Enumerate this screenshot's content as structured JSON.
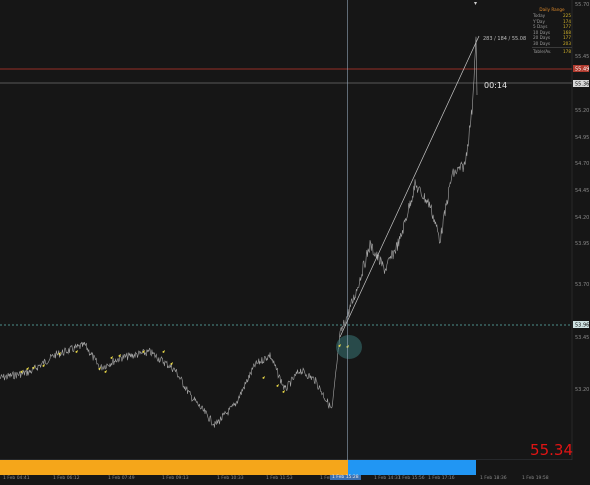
{
  "price_axis": {
    "ticks": [
      "55.70",
      "55.45",
      "55.20",
      "54.95",
      "54.70",
      "54.45",
      "54.20",
      "53.95",
      "53.70",
      "53.45",
      "53.20"
    ],
    "current_price_label": "55.36",
    "red_line_label": "55.49",
    "crosshair_price_label": "53.96"
  },
  "big_price": "55.34",
  "timer": "00:14",
  "hover_text": "283 / 184 / 55.08",
  "range_panel": {
    "title": "Daily Range",
    "rows": [
      {
        "label": "Today",
        "value": "225"
      },
      {
        "label": "Y'Day",
        "value": "174"
      },
      {
        "label": "5 Days",
        "value": "177"
      },
      {
        "label": "10 Days",
        "value": "168"
      },
      {
        "label": "20 Days",
        "value": "177"
      },
      {
        "label": "30 Days",
        "value": "203"
      }
    ],
    "footer_label": "Table/Av.",
    "footer_value": "178"
  },
  "time_axis": {
    "labels": [
      "1 Feb 04:41",
      "1 Feb 06:12",
      "1 Feb 07:49",
      "1 Feb 09:13",
      "1 Feb 10:33",
      "1 Feb 11:53",
      "1 Feb 13:14",
      "1 Feb 14:37",
      "1 Feb 15:56",
      "1 Feb 17:16",
      "1 Feb 18:36",
      "1 Feb 19:58"
    ],
    "cursor_label": "1 Feb 15:28"
  },
  "colors": {
    "background": "#161616",
    "price_line": "#a8a8a8",
    "red_line": "#e53935",
    "dashed_line": "#5fb8b0",
    "session_orange": "#f5a61a",
    "session_blue": "#2196f3",
    "marker_yellow": "#f2e14a"
  }
}
